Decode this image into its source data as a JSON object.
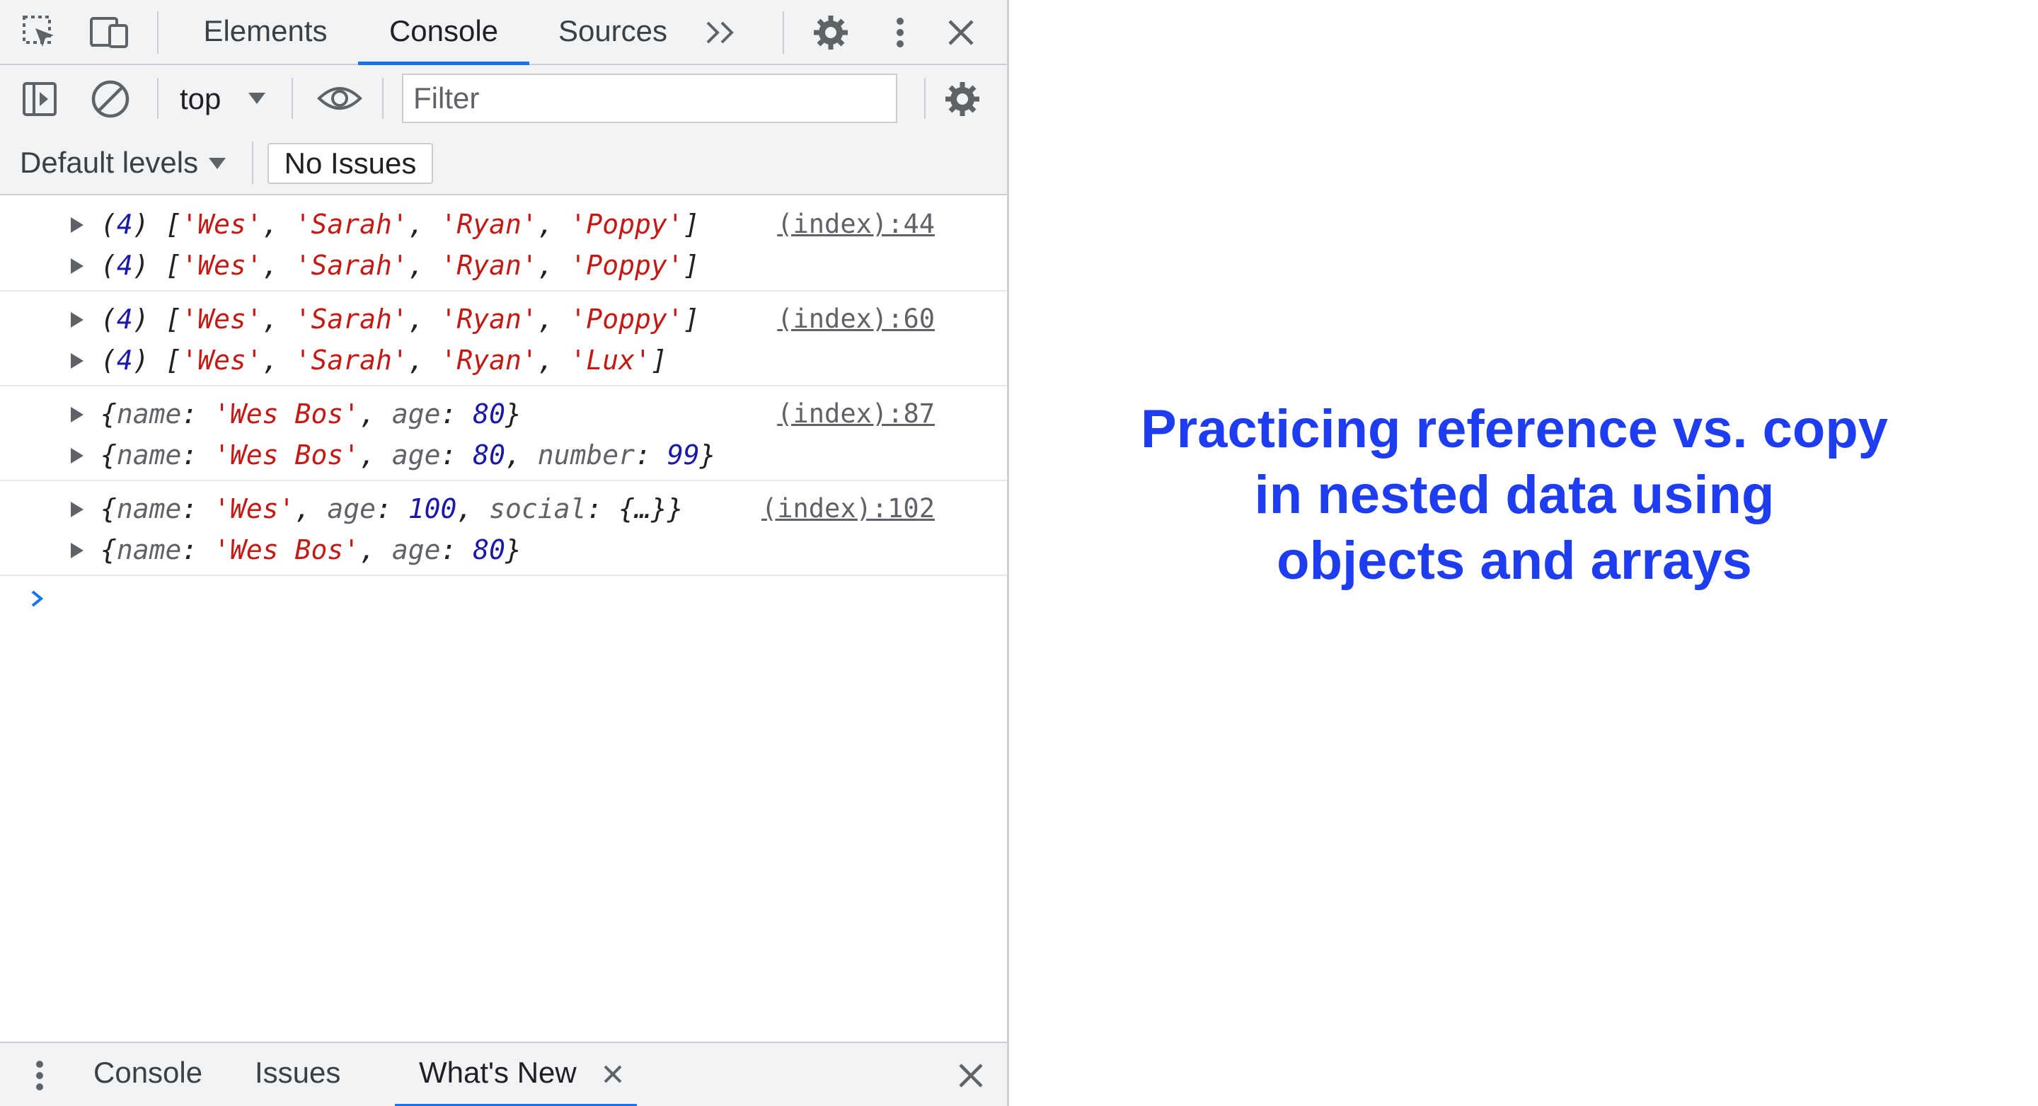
{
  "devtools": {
    "tabs": [
      {
        "label": "Elements"
      },
      {
        "label": "Console",
        "active": true
      },
      {
        "label": "Sources"
      }
    ],
    "toolbar": {
      "context": "top",
      "filter_placeholder": "Filter",
      "levels": "Default levels",
      "issues": "No Issues"
    },
    "messages": [
      {
        "source": "(index):44",
        "lines": [
          "(4) ['Wes', 'Sarah', 'Ryan', 'Poppy']",
          "(4) ['Wes', 'Sarah', 'Ryan', 'Poppy']"
        ]
      },
      {
        "source": "(index):60",
        "lines": [
          "(4) ['Wes', 'Sarah', 'Ryan', 'Poppy']",
          "(4) ['Wes', 'Sarah', 'Ryan', 'Lux']"
        ]
      },
      {
        "source": "(index):87",
        "lines": [
          "{name: 'Wes Bos', age: 80}",
          "{name: 'Wes Bos', age: 80, number: 99}"
        ]
      },
      {
        "source": "(index):102",
        "lines": [
          "{name: 'Wes', age: 100, social: {…}}",
          "{name: 'Wes Bos', age: 80}"
        ]
      }
    ],
    "drawer": {
      "tabs": [
        {
          "label": "Console"
        },
        {
          "label": "Issues"
        },
        {
          "label": "What's New",
          "active": true
        }
      ]
    }
  },
  "caption": {
    "lines": [
      "Practicing reference vs. copy",
      "in nested data using",
      "objects and arrays"
    ]
  },
  "colors": {
    "accent": "#1a73e8",
    "string": "#c41a16",
    "number": "#1a1aa6",
    "caption": "#1f3df0"
  },
  "icons": [
    "inspect-element-icon",
    "device-toolbar-icon",
    "more-tabs-icon",
    "settings-icon",
    "kebab-menu-icon",
    "close-icon",
    "sidebar-toggle-icon",
    "clear-console-icon",
    "dropdown-arrow-icon",
    "live-expression-eye-icon",
    "console-settings-icon",
    "prompt-chevron-icon",
    "drawer-menu-icon",
    "close-tab-icon",
    "close-drawer-icon"
  ]
}
